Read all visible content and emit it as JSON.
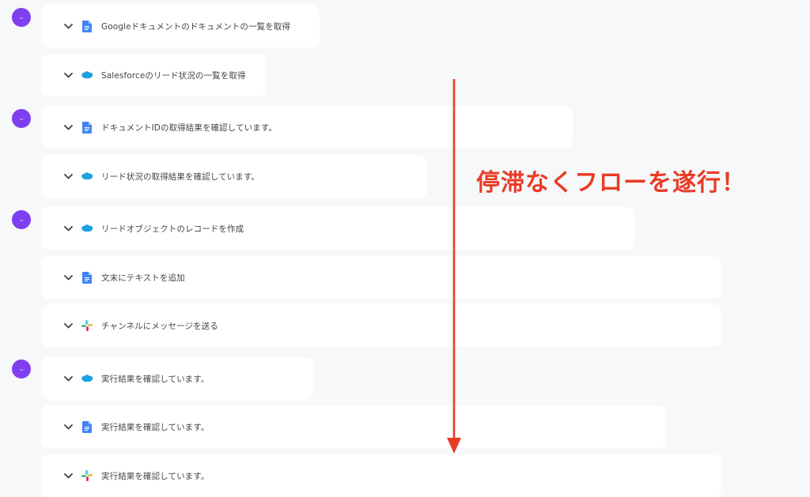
{
  "groups": [
    {
      "items": [
        {
          "service": "google-doc",
          "label": "Googleドキュメントのドキュメントの一覧を取得"
        },
        {
          "service": "salesforce",
          "label": "Salesforceのリード状況の一覧を取得"
        }
      ]
    },
    {
      "items": [
        {
          "service": "google-doc",
          "label": "ドキュメントIDの取得結果を確認しています。"
        },
        {
          "service": "salesforce",
          "label": "リード状況の取得結果を確認しています。"
        }
      ]
    },
    {
      "items": [
        {
          "service": "salesforce",
          "label": "リードオブジェクトのレコードを作成"
        },
        {
          "service": "google-doc",
          "label": "文末にテキストを追加"
        },
        {
          "service": "slack",
          "label": "チャンネルにメッセージを送る"
        }
      ]
    },
    {
      "items": [
        {
          "service": "salesforce",
          "label": "実行結果を確認しています。"
        },
        {
          "service": "google-doc",
          "label": "実行結果を確認しています。"
        },
        {
          "service": "slack",
          "label": "実行結果を確認しています。"
        }
      ]
    }
  ],
  "annotation": "停滞なくフローを遂行！",
  "colors": {
    "avatar": "#7f3ff0",
    "arrow": "#ea3b25",
    "google_doc": "#4285f4",
    "salesforce": "#1ba1e0"
  },
  "icons": {
    "expand": "chevron-down-icon",
    "google-doc": "google-doc-icon",
    "salesforce": "salesforce-cloud-icon",
    "slack": "slack-icon"
  }
}
